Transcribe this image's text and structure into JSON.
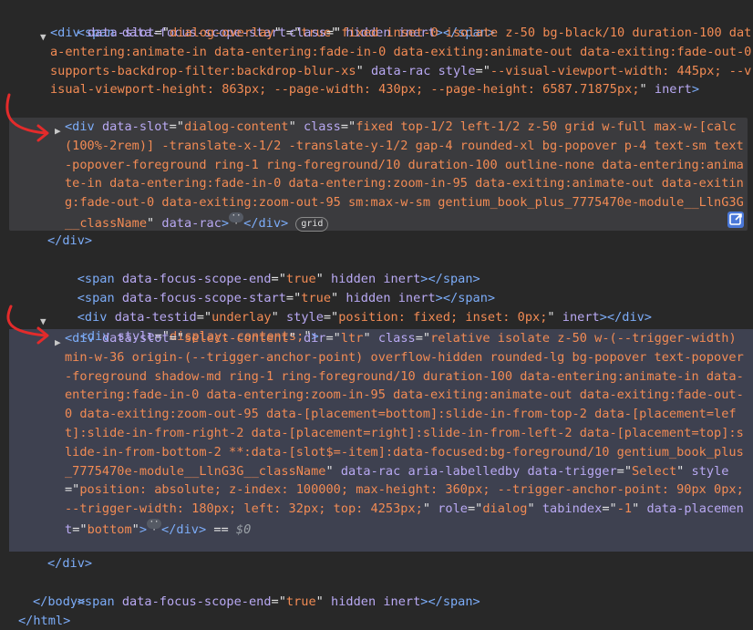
{
  "code": {
    "l1": {
      "a": "<span ",
      "b": "data-focus-scope-start",
      "c": "=\"",
      "d": "true",
      "e": "\" ",
      "f": "hidden inert",
      "g": "></span>"
    },
    "l2": "<div data-slot=\"dialog-overlay\" class=\"fixed inset-0 isolate z-50 bg-black/10 duration-100 data-entering:animate-in data-entering:fade-in-0 data-exiting:animate-out data-exiting:fade-out-0 supports-backdrop-filter:backdrop-blur-xs\" data-rac style=\"--visual-viewport-width: 445px; --visual-viewport-height: 863px; --page-width: 430px; --page-height: 6587.71875px;\" inert>",
    "l3": "<div data-slot=\"dialog-content\" class=\"fixed top-1/2 left-1/2 z-50 grid w-full max-w-[calc(100%-2rem)] -translate-x-1/2 -translate-y-1/2 gap-4 rounded-xl bg-popover p-4 text-sm text-popover-foreground ring-1 ring-foreground/10 duration-100 outline-none data-entering:animate-in data-entering:fade-in-0 data-entering:zoom-in-95 data-exiting:animate-out data-exiting:fade-out-0 data-exiting:zoom-out-95 sm:max-w-sm gentium_book_plus_7775470e-module__LlnG3G__className\" data-rac>",
    "l3_close": "</div>",
    "l3_badge": "grid",
    "l4": "</div>",
    "l5": "<span data-focus-scope-end=\"true\" hidden inert></span>",
    "l6": "<span data-focus-scope-start=\"true\" hidden inert></span>",
    "l7": "<div data-testid=\"underlay\" style=\"position: fixed; inset: 0px;\" inert></div>",
    "l8": "<div style=\"display: contents;\">",
    "l9": "<div data-slot=\"select-content\" dir=\"ltr\" class=\"relative isolate z-50 w-(--trigger-width) min-w-36 origin-(--trigger-anchor-point) overflow-hidden rounded-lg bg-popover text-popover-foreground shadow-md ring-1 ring-foreground/10 duration-100 data-entering:animate-in data-entering:fade-in-0 data-entering:zoom-in-95 data-exiting:animate-out data-exiting:fade-out-0 data-exiting:zoom-out-95 data-[placement=bottom]:slide-in-from-top-2 data-[placement=left]:slide-in-from-right-2 data-[placement=right]:slide-in-from-left-2 data-[placement=top]:slide-in-from-bottom-2 **:data-[slot$=-item]:data-focused:bg-foreground/10 gentium_book_plus_7775470e-module__LlnG3G__className\" data-rac aria-labelledby data-trigger=\"Select\" style=\"position: absolute; z-index: 100000; max-height: 360px; --trigger-anchor-point: 90px 0px; --trigger-width: 180px; left: 32px; top: 4253px;\" role=\"dialog\" tabindex=\"-1\" data-placement=\"bottom\">",
    "l9_close": "</div>",
    "l9_eq": "==",
    "l9_dollar": "$0",
    "l10": "</div>",
    "l11": "<span data-focus-scope-end=\"true\" hidden inert></span>",
    "l12": "</body>",
    "l13": "</html>"
  },
  "icons": {
    "expand": "triangle-right-icon",
    "collapse": "triangle-down-icon",
    "edit": "edit-badge-icon"
  },
  "colors": {
    "background": "#282828",
    "selected_row": "#3e4150",
    "hover_row": "#3b3b3e",
    "tag": "#7cacf8",
    "attr_name": "#b9a9f3",
    "attr_value": "#f28b54",
    "annotation_arrow": "#e32b2b"
  }
}
